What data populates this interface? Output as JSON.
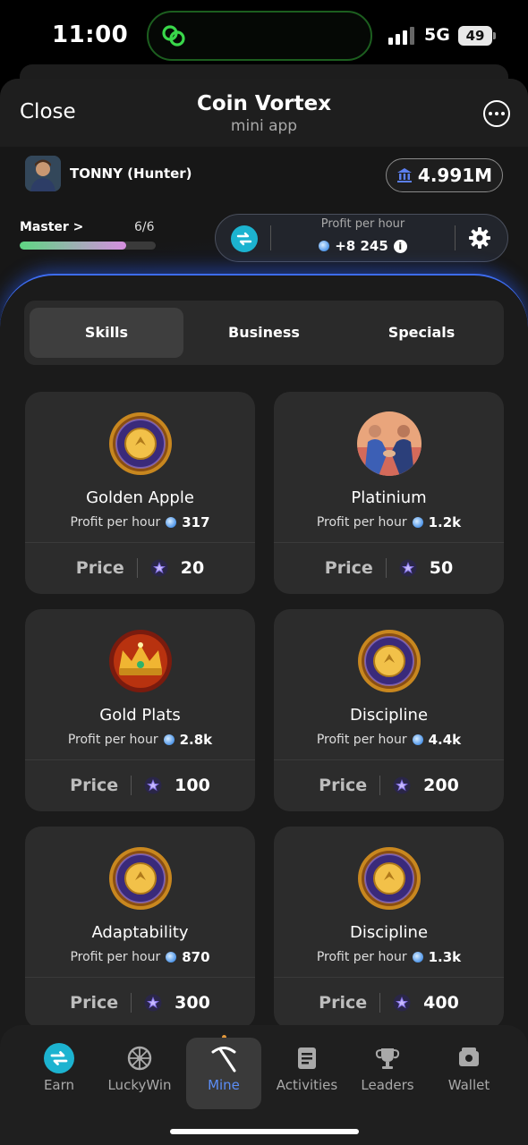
{
  "status_bar": {
    "time": "11:00",
    "network": "5G",
    "battery": "49"
  },
  "header": {
    "close_label": "Close",
    "title": "Coin Vortex",
    "subtitle": "mini app"
  },
  "user": {
    "name": "TONNY (Hunter)",
    "balance": "4.991M"
  },
  "level": {
    "label": "Master >",
    "count": "6/6",
    "progress": 0.78
  },
  "profit": {
    "label": "Profit per hour",
    "value": "+8 245"
  },
  "tabs": [
    {
      "label": "Skills",
      "active": true
    },
    {
      "label": "Business",
      "active": false
    },
    {
      "label": "Specials",
      "active": false
    }
  ],
  "cards": [
    {
      "name": "Golden Apple",
      "pph_label": "Profit per hour",
      "pph": "317",
      "price_label": "Price",
      "price": "20",
      "icon": "medallion-icon"
    },
    {
      "name": "Platinium",
      "pph_label": "Profit per hour",
      "pph": "1.2k",
      "price_label": "Price",
      "price": "50",
      "icon": "handshake-icon"
    },
    {
      "name": "Gold Plats",
      "pph_label": "Profit per hour",
      "pph": "2.8k",
      "price_label": "Price",
      "price": "100",
      "icon": "crown-icon"
    },
    {
      "name": "Discipline",
      "pph_label": "Profit per hour",
      "pph": "4.4k",
      "price_label": "Price",
      "price": "200",
      "icon": "medallion-icon"
    },
    {
      "name": "Adaptability",
      "pph_label": "Profit per hour",
      "pph": "870",
      "price_label": "Price",
      "price": "300",
      "icon": "medallion-icon"
    },
    {
      "name": "Discipline",
      "pph_label": "Profit per hour",
      "pph": "1.3k",
      "price_label": "Price",
      "price": "400",
      "icon": "medallion-icon"
    }
  ],
  "nav": [
    {
      "label": "Earn",
      "icon": "earn-icon",
      "active": false
    },
    {
      "label": "LuckyWin",
      "icon": "wheel-icon",
      "active": false
    },
    {
      "label": "Mine",
      "icon": "pickaxe-icon",
      "active": true
    },
    {
      "label": "Activities",
      "icon": "list-icon",
      "active": false
    },
    {
      "label": "Leaders",
      "icon": "trophy-icon",
      "active": false
    },
    {
      "label": "Wallet",
      "icon": "wallet-icon",
      "active": false
    }
  ],
  "colors": {
    "accent_blue": "#5b8df6",
    "glow": "#3d6cf0",
    "card_bg": "#2c2c2c",
    "brand_teal": "#1cb3d0"
  }
}
